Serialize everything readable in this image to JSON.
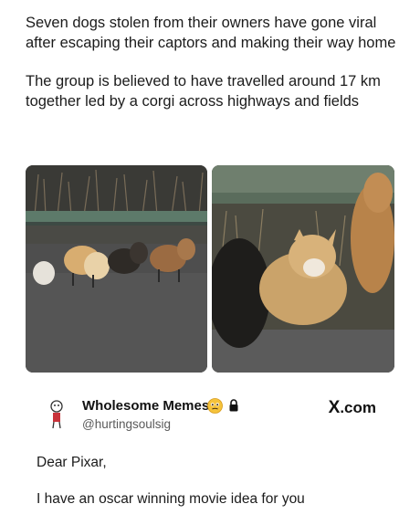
{
  "article": {
    "paragraphs": [
      "Seven dogs stolen from their owners have gone viral after escaping their captors and making their way home",
      "The group is believed to have travelled around 17 km together led by a corgi across highways and fields"
    ]
  },
  "photos": [
    {
      "icon": "dogs-on-road-photo"
    },
    {
      "icon": "corgi-closeup-photo"
    }
  ],
  "tweet": {
    "display_name": "Wholesome Memes",
    "handle": "@hurtingsoulsig",
    "badge_emoji": "🥹",
    "source": ".com",
    "source_glyph": "X",
    "lines": [
      "Dear Pixar,",
      "I have an oscar winning movie idea for you"
    ]
  },
  "colors": {
    "text": "#1b1b1b",
    "handle": "#5a5a5a",
    "avatar_accent": "#c8323a"
  }
}
